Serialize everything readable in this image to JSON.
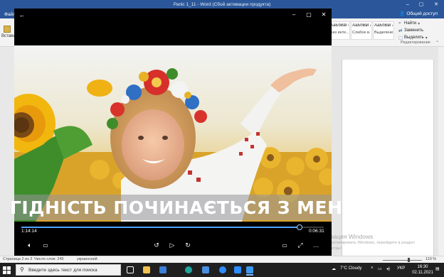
{
  "word": {
    "title": "Рапіс 1_11 - Word (Сбой активации продукта)",
    "menu_file": "Файл",
    "share": "Общий доступ",
    "paste_label": "Встави",
    "styles": [
      {
        "sample": "АаБбВвГг",
        "name": "Без инте..."
      },
      {
        "sample": "АаБбВвГг",
        "name": "Слабое в..."
      },
      {
        "sample": "АаБбВвГг",
        "name": "Выделение"
      }
    ],
    "edit": {
      "find": "Найти",
      "replace": "Заменить",
      "select": "Выделить",
      "group_label": "Редактирование"
    },
    "status": {
      "page": "Страница 2 из 3",
      "words": "Число слов: 245",
      "language": "украинский",
      "zoom": "110 %"
    }
  },
  "activation": {
    "title": "Активация Windows",
    "line1": "Чтобы активировать Windows, перейдите в раздел",
    "line2": "\"Параметры\"."
  },
  "player": {
    "caption": "ГІДНІСТЬ ПОЧИНАЄТЬСЯ З МЕНЕ",
    "time_current": "1:14:14",
    "time_remaining": "0:06:31",
    "progress": 0.919,
    "colors": {
      "accent": "#4fa3ff",
      "background": "#000000"
    }
  },
  "taskbar": {
    "search_placeholder": "Введите здесь текст для поиска",
    "weather": "7°C  Cloudy",
    "language": "УКР",
    "time": "16:30",
    "date": "02.11.2021",
    "apps": [
      "task-view-icon",
      "explorer-icon",
      "edge-icon",
      "store-icon",
      "zoom-icon",
      "zoom-meetings-icon",
      "photos-icon"
    ]
  }
}
